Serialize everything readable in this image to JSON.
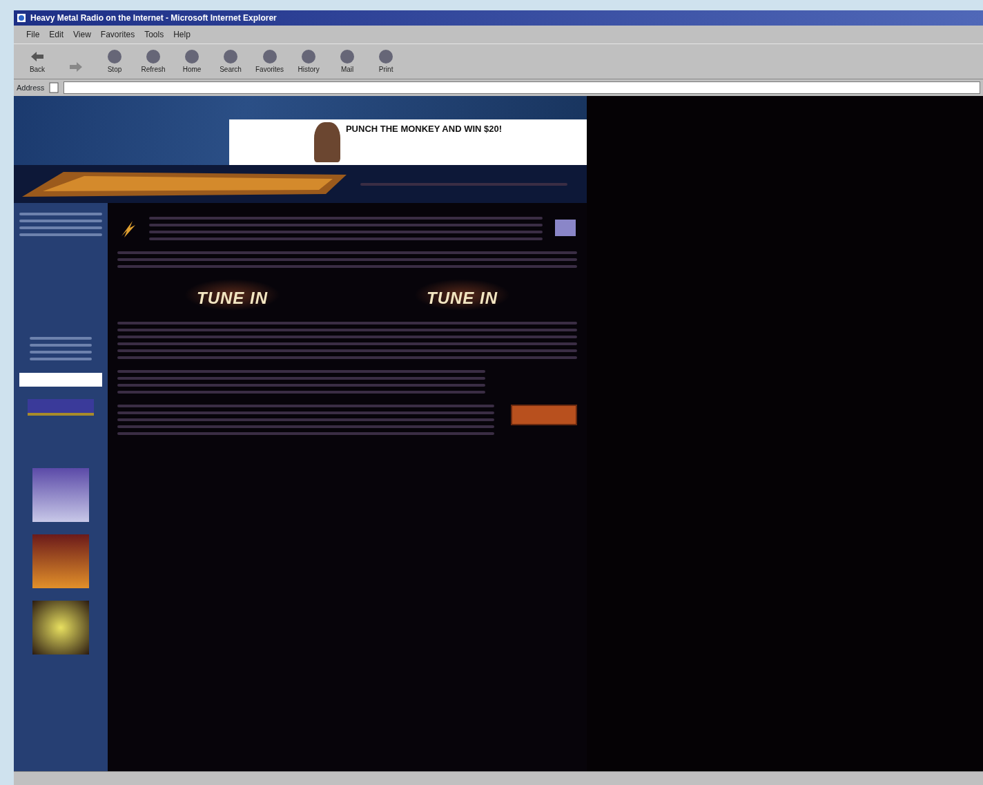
{
  "window": {
    "title": "Heavy Metal Radio on the Internet - Microsoft Internet Explorer"
  },
  "menu_bar": [
    "File",
    "Edit",
    "View",
    "Favorites",
    "Tools",
    "Help"
  ],
  "toolbar": [
    {
      "kind": "back",
      "label": "Back"
    },
    {
      "kind": "forward"
    },
    {
      "kind": "button",
      "label": "Stop"
    },
    {
      "kind": "button",
      "label": "Refresh"
    },
    {
      "kind": "button",
      "label": "Home"
    },
    {
      "kind": "button",
      "label": "Search"
    },
    {
      "kind": "button",
      "label": "Favorites"
    },
    {
      "kind": "button",
      "label": "History"
    },
    {
      "kind": "button",
      "label": "Mail"
    },
    {
      "kind": "button",
      "label": "Print"
    }
  ],
  "address_bar": {
    "label": "Address"
  },
  "banner_ad": {
    "text": "PUNCH THE MONKEY AND WIN $20!"
  },
  "tune_in": [
    "TUNE IN",
    "TUNE IN"
  ]
}
